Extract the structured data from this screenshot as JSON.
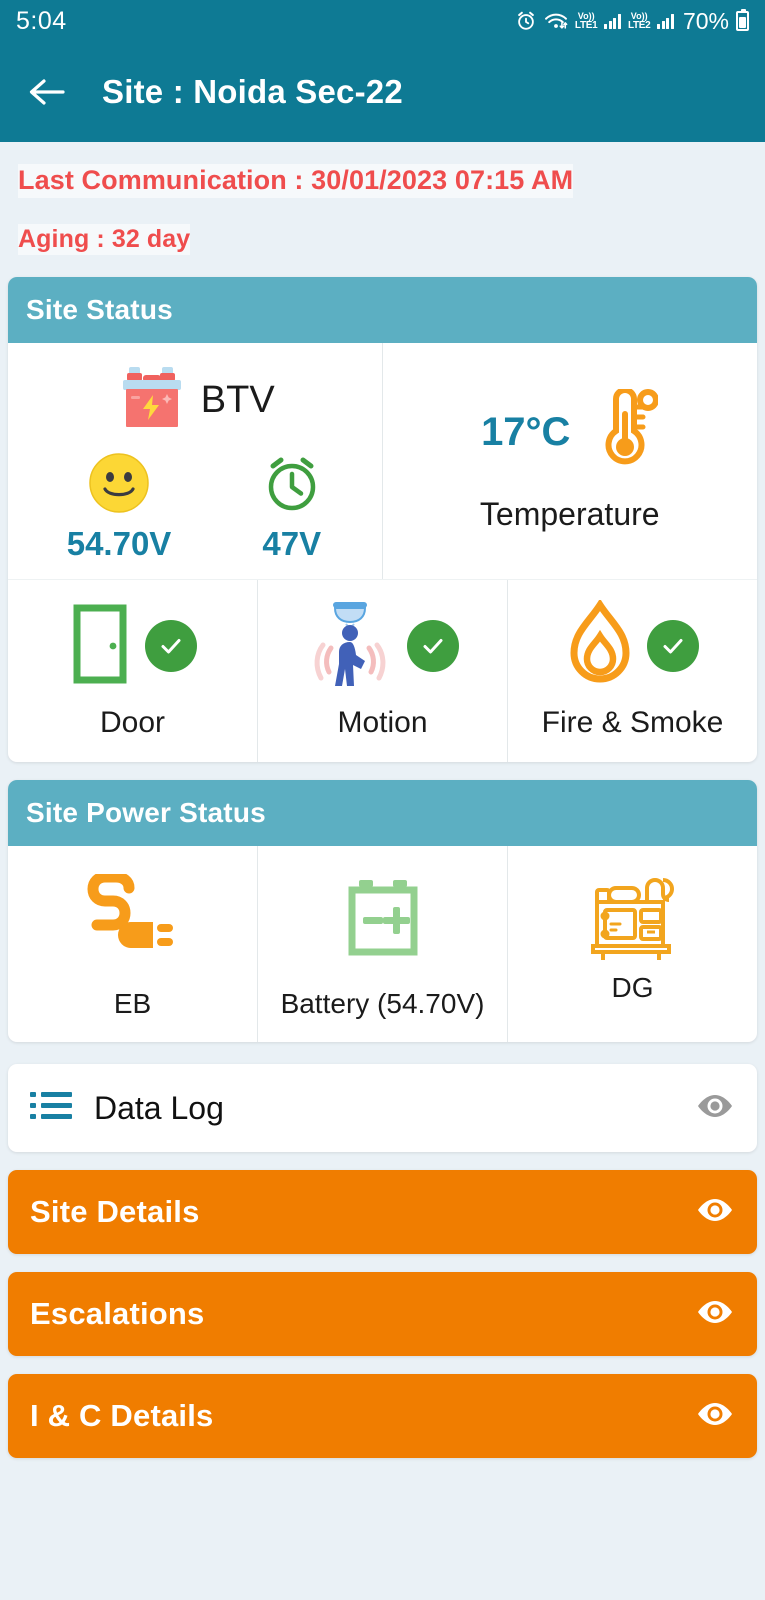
{
  "status_bar": {
    "time": "5:04",
    "battery_percent": "70%",
    "icons": [
      "alarm-icon",
      "wifi-icon",
      "volte-lte1-icon",
      "signal-bars-1-icon",
      "volte-lte2-icon",
      "signal-bars-2-icon",
      "battery-icon"
    ],
    "volte1_top": "Vo))",
    "volte1_bottom": "LTE1",
    "volte2_top": "Vo))",
    "volte2_bottom": "LTE2"
  },
  "appbar": {
    "title": "Site : Noida Sec-22",
    "back_icon": "arrow-left-icon",
    "background": "#0e7a94"
  },
  "meta": {
    "last_communication": "Last Communication : 30/01/2023 07:15 AM",
    "aging": "Aging : 32 day",
    "color": "#ef4d4d"
  },
  "site_status": {
    "header": "Site Status",
    "header_color": "#5cafc2",
    "btv_label": "BTV",
    "btv_icon": "battery-btv-icon",
    "voltage_primary": {
      "icon": "smiley-face-icon",
      "value": "54.70V"
    },
    "voltage_secondary": {
      "icon": "alarm-clock-icon",
      "value": "47V"
    },
    "temperature": {
      "value": "17°C",
      "label": "Temperature",
      "icon": "thermometer-icon"
    },
    "sensors": [
      {
        "label": "Door",
        "icon": "door-icon",
        "status_icon": "check-circle-icon",
        "status_color": "#3f9e3f"
      },
      {
        "label": "Motion",
        "icon": "motion-detector-icon",
        "status_icon": "check-circle-icon",
        "status_color": "#3f9e3f"
      },
      {
        "label": "Fire & Smoke",
        "icon": "flame-icon",
        "status_icon": "check-circle-icon",
        "status_color": "#3f9e3f"
      }
    ]
  },
  "site_power_status": {
    "header": "Site Power Status",
    "items": [
      {
        "label": "EB",
        "icon": "power-plug-icon"
      },
      {
        "label": "Battery (54.70V)",
        "icon": "battery-outline-icon"
      },
      {
        "label": "DG",
        "icon": "diesel-generator-icon"
      }
    ]
  },
  "data_log": {
    "label": "Data Log",
    "list_icon": "list-icon",
    "eye_icon": "eye-icon"
  },
  "action_buttons": [
    {
      "label": "Site Details",
      "eye_icon": "eye-icon"
    },
    {
      "label": "Escalations",
      "eye_icon": "eye-icon"
    },
    {
      "label": "I & C Details",
      "eye_icon": "eye-icon"
    }
  ],
  "colors": {
    "accent_teal": "#0e7a94",
    "header_teal": "#5cafc2",
    "orange": "#f07d00",
    "red": "#ef4d4d",
    "green": "#3f9e3f",
    "value_blue": "#1880a3"
  }
}
